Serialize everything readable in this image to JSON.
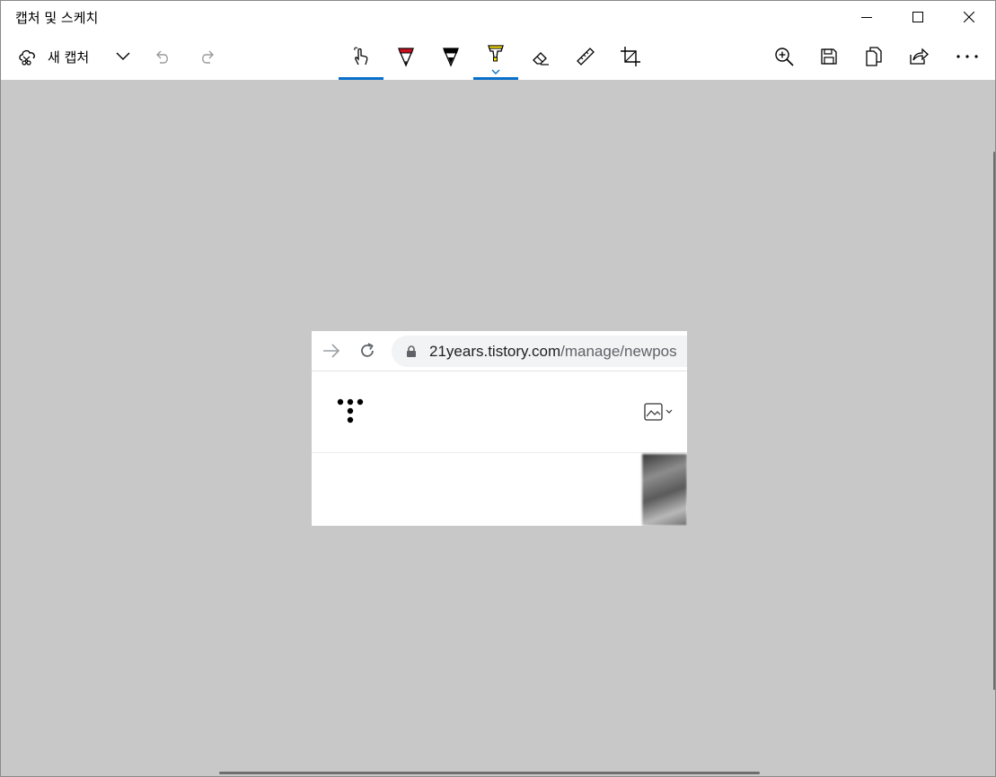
{
  "window": {
    "title": "캡처 및 스케치"
  },
  "toolbar": {
    "new_capture_label": "새 캡처",
    "icons": {
      "new_capture": "new-capture-icon",
      "dropdown": "chevron-down-icon",
      "undo": "undo-icon",
      "redo": "redo-icon",
      "touch_writing": "touch-writing-icon",
      "ballpoint_pen": "ballpoint-pen-icon",
      "pencil": "pencil-icon",
      "highlighter": "highlighter-icon",
      "eraser": "eraser-icon",
      "ruler": "ruler-icon",
      "crop": "crop-icon",
      "zoom": "zoom-in-icon",
      "save": "save-icon",
      "copy": "copy-icon",
      "share": "share-icon",
      "more": "more-icon"
    },
    "active_tools": [
      "touch_writing",
      "highlighter"
    ]
  },
  "colors": {
    "accent": "#0a6fc9",
    "pen_red": "#c50f1f",
    "highlighter_yellow": "#ffe600",
    "canvas_bg": "#c8c8c8"
  },
  "capture": {
    "url_host": "21years.tistory.com",
    "url_path": "/manage/newpos"
  }
}
